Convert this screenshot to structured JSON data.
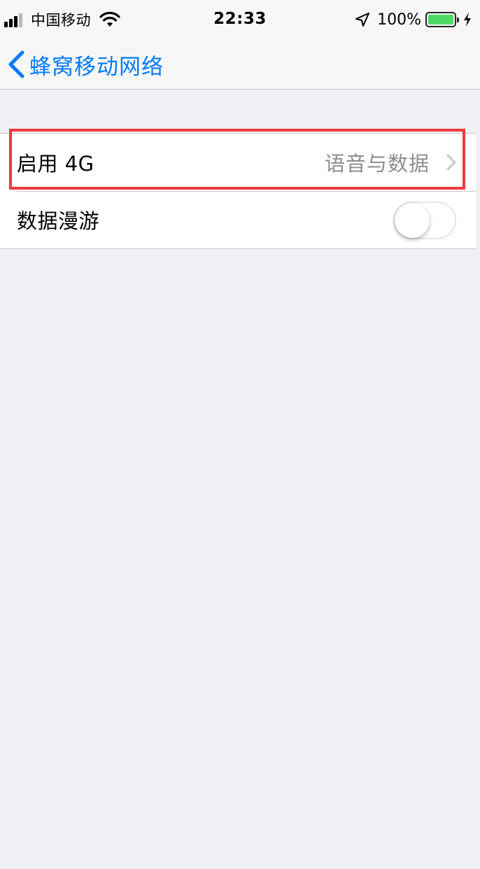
{
  "status_bar": {
    "carrier": "中国移动",
    "time": "22:33",
    "battery_percent": "100%",
    "signal_bars_active": 3,
    "signal_bars_total": 4,
    "battery_color": "#4cd964",
    "icons": [
      "signal-icon",
      "wifi-icon",
      "location-arrow-icon",
      "battery-icon",
      "charging-bolt-icon"
    ]
  },
  "nav": {
    "back_label": "蜂窝移动网络",
    "accent_color": "#007aff"
  },
  "settings": [
    {
      "label": "启用 4G",
      "detail": "语音与数据",
      "type": "disclosure"
    },
    {
      "label": "数据漫游",
      "type": "toggle",
      "on": false
    }
  ],
  "annotation": {
    "highlight_color": "#ee3b3b",
    "highlighted_row": "启用 4G"
  }
}
